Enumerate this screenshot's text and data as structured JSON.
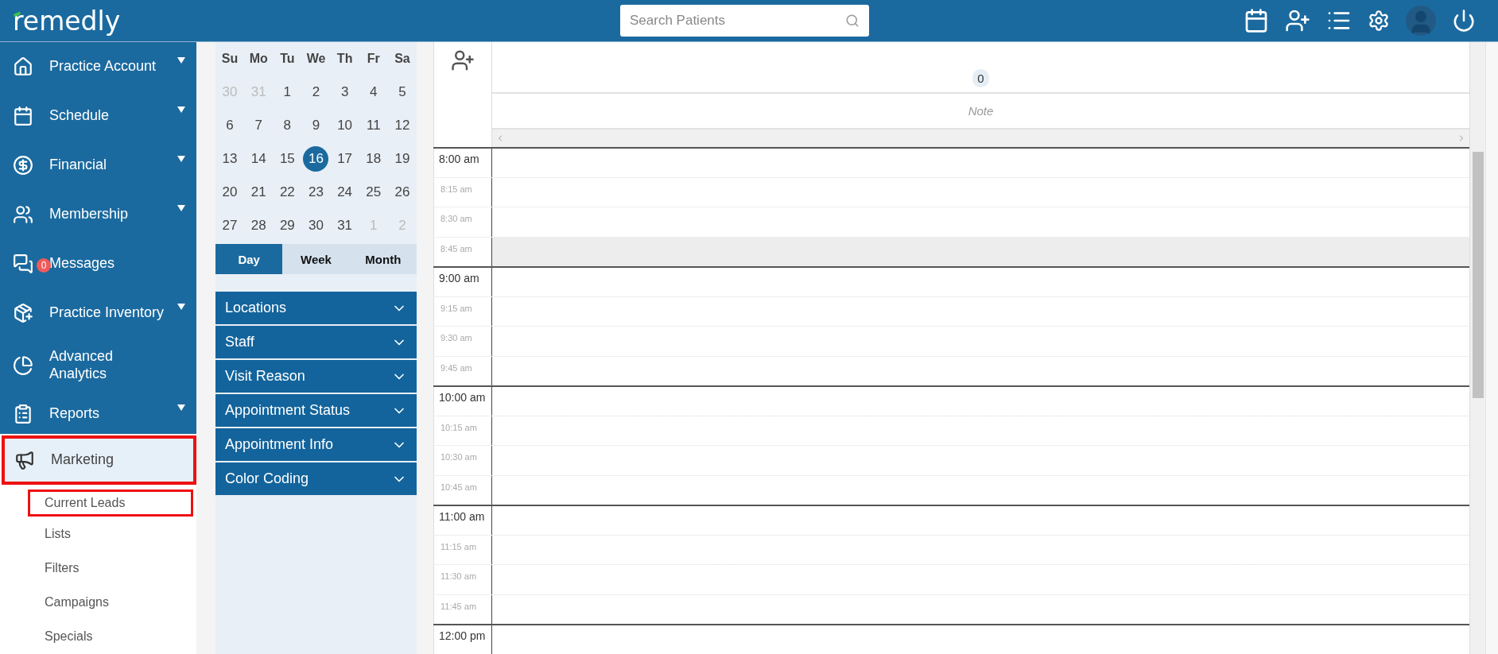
{
  "header": {
    "logo": "remedly",
    "search": {
      "placeholder": "Search Patients"
    }
  },
  "sidebar": {
    "items": [
      {
        "label": "Practice Account",
        "expandable": true,
        "selected": false,
        "highlighted": false
      },
      {
        "label": "Schedule",
        "expandable": true,
        "selected": false,
        "highlighted": false
      },
      {
        "label": "Financial",
        "expandable": true,
        "selected": false,
        "highlighted": false
      },
      {
        "label": "Membership",
        "expandable": true,
        "selected": false,
        "highlighted": false
      },
      {
        "label": "Messages",
        "expandable": false,
        "badge": "0",
        "selected": false,
        "highlighted": false
      },
      {
        "label": "Practice Inventory",
        "expandable": true,
        "selected": false,
        "highlighted": false
      },
      {
        "label": "Advanced Analytics",
        "expandable": false,
        "selected": false,
        "highlighted": false
      },
      {
        "label": "Reports",
        "expandable": true,
        "selected": false,
        "highlighted": false
      },
      {
        "label": "Marketing",
        "expandable": false,
        "selected": true,
        "highlighted": true,
        "children": [
          {
            "label": "Current Leads",
            "highlighted": true
          },
          {
            "label": "Lists",
            "highlighted": false
          },
          {
            "label": "Filters",
            "highlighted": false
          },
          {
            "label": "Campaigns",
            "highlighted": false
          },
          {
            "label": "Specials",
            "highlighted": false
          }
        ]
      }
    ]
  },
  "calendar": {
    "weekdays": [
      "Su",
      "Mo",
      "Tu",
      "We",
      "Th",
      "Fr",
      "Sa"
    ],
    "weeks": [
      [
        {
          "day": "30",
          "outside": true,
          "selected": false
        },
        {
          "day": "31",
          "outside": true,
          "selected": false
        },
        {
          "day": "1",
          "outside": false,
          "selected": false
        },
        {
          "day": "2",
          "outside": false,
          "selected": false
        },
        {
          "day": "3",
          "outside": false,
          "selected": false
        },
        {
          "day": "4",
          "outside": false,
          "selected": false
        },
        {
          "day": "5",
          "outside": false,
          "selected": false
        }
      ],
      [
        {
          "day": "6",
          "outside": false,
          "selected": false
        },
        {
          "day": "7",
          "outside": false,
          "selected": false
        },
        {
          "day": "8",
          "outside": false,
          "selected": false
        },
        {
          "day": "9",
          "outside": false,
          "selected": false
        },
        {
          "day": "10",
          "outside": false,
          "selected": false
        },
        {
          "day": "11",
          "outside": false,
          "selected": false
        },
        {
          "day": "12",
          "outside": false,
          "selected": false
        }
      ],
      [
        {
          "day": "13",
          "outside": false,
          "selected": false
        },
        {
          "day": "14",
          "outside": false,
          "selected": false
        },
        {
          "day": "15",
          "outside": false,
          "selected": false
        },
        {
          "day": "16",
          "outside": false,
          "selected": true
        },
        {
          "day": "17",
          "outside": false,
          "selected": false
        },
        {
          "day": "18",
          "outside": false,
          "selected": false
        },
        {
          "day": "19",
          "outside": false,
          "selected": false
        }
      ],
      [
        {
          "day": "20",
          "outside": false,
          "selected": false
        },
        {
          "day": "21",
          "outside": false,
          "selected": false
        },
        {
          "day": "22",
          "outside": false,
          "selected": false
        },
        {
          "day": "23",
          "outside": false,
          "selected": false
        },
        {
          "day": "24",
          "outside": false,
          "selected": false
        },
        {
          "day": "25",
          "outside": false,
          "selected": false
        },
        {
          "day": "26",
          "outside": false,
          "selected": false
        }
      ],
      [
        {
          "day": "27",
          "outside": false,
          "selected": false
        },
        {
          "day": "28",
          "outside": false,
          "selected": false
        },
        {
          "day": "29",
          "outside": false,
          "selected": false
        },
        {
          "day": "30",
          "outside": false,
          "selected": false
        },
        {
          "day": "31",
          "outside": false,
          "selected": false
        },
        {
          "day": "1",
          "outside": true,
          "selected": false
        },
        {
          "day": "2",
          "outside": true,
          "selected": false
        }
      ]
    ],
    "views": [
      {
        "label": "Day",
        "selected": true
      },
      {
        "label": "Week",
        "selected": false
      },
      {
        "label": "Month",
        "selected": false
      }
    ],
    "filters": [
      {
        "label": "Locations",
        "expanded": false
      },
      {
        "label": "Staff",
        "expanded": false
      },
      {
        "label": "Visit Reason",
        "expanded": false
      },
      {
        "label": "Appointment Status",
        "expanded": false
      },
      {
        "label": "Appointment Info",
        "expanded": false
      },
      {
        "label": "Color Coding",
        "expanded": false
      }
    ]
  },
  "schedule": {
    "column_count": "0",
    "note": "Note",
    "slots": [
      {
        "time": "8:00 am",
        "major": true,
        "highlighted": false
      },
      {
        "time": "8:15 am",
        "major": false,
        "highlighted": false
      },
      {
        "time": "8:30 am",
        "major": false,
        "highlighted": false
      },
      {
        "time": "8:45 am",
        "major": false,
        "highlighted": true
      },
      {
        "time": "9:00 am",
        "major": true,
        "highlighted": false
      },
      {
        "time": "9:15 am",
        "major": false,
        "highlighted": false
      },
      {
        "time": "9:30 am",
        "major": false,
        "highlighted": false
      },
      {
        "time": "9:45 am",
        "major": false,
        "highlighted": false
      },
      {
        "time": "10:00 am",
        "major": true,
        "highlighted": false
      },
      {
        "time": "10:15 am",
        "major": false,
        "highlighted": false
      },
      {
        "time": "10:30 am",
        "major": false,
        "highlighted": false
      },
      {
        "time": "10:45 am",
        "major": false,
        "highlighted": false
      },
      {
        "time": "11:00 am",
        "major": true,
        "highlighted": false
      },
      {
        "time": "11:15 am",
        "major": false,
        "highlighted": false
      },
      {
        "time": "11:30 am",
        "major": false,
        "highlighted": false
      },
      {
        "time": "11:45 am",
        "major": false,
        "highlighted": false
      },
      {
        "time": "12:00 pm",
        "major": true,
        "highlighted": false
      }
    ]
  }
}
